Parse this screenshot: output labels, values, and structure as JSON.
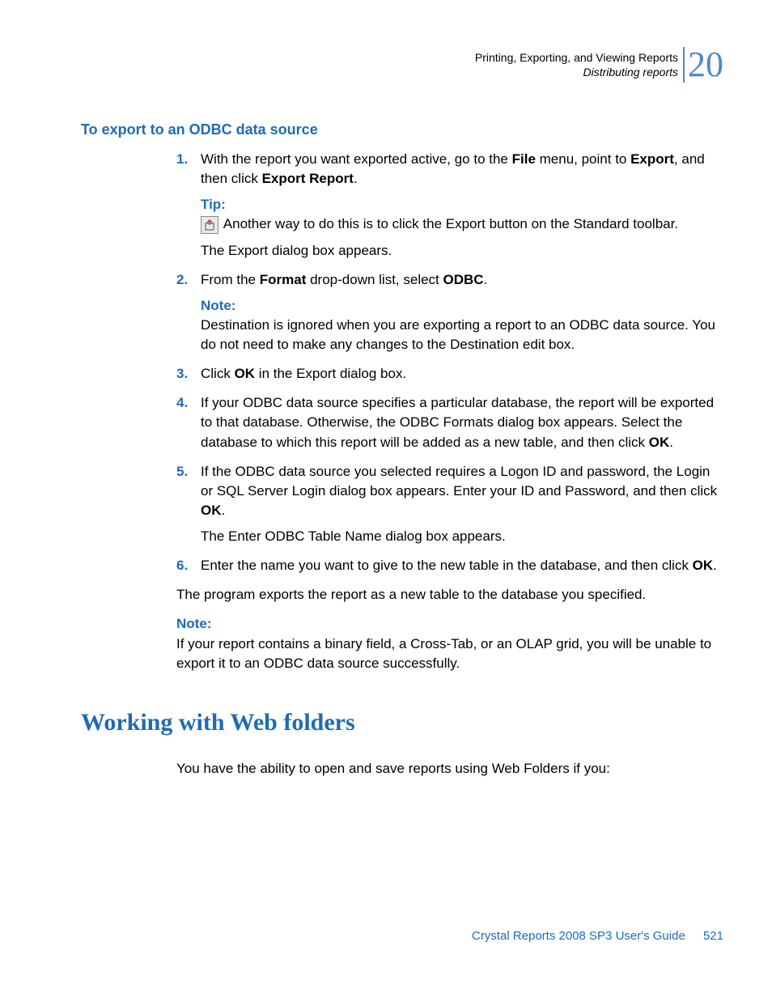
{
  "header": {
    "line1": "Printing, Exporting, and Viewing Reports",
    "line2": "Distributing reports",
    "chapter": "20"
  },
  "section_heading": "To export to an ODBC data source",
  "steps": [
    {
      "num": "1.",
      "parts": {
        "p1a": "With the report you want exported active, go to the ",
        "p1b": "File",
        "p1c": " menu, point to ",
        "p1d": "Export",
        "p1e": ", and then click ",
        "p1f": "Export Report",
        "p1g": ".",
        "tip_label": "Tip:",
        "tip_text": " Another way to do this is to click the Export button on the Standard toolbar.",
        "after": "The Export dialog box appears."
      }
    },
    {
      "num": "2.",
      "parts": {
        "p1a": "From the ",
        "p1b": "Format",
        "p1c": " drop-down list, select ",
        "p1d": "ODBC",
        "p1e": ".",
        "note_label": "Note:",
        "note_text": "Destination is ignored when you are exporting a report to an ODBC data source. You do not need to make any changes to the Destination edit box."
      }
    },
    {
      "num": "3.",
      "parts": {
        "p1a": "Click ",
        "p1b": "OK",
        "p1c": " in the Export dialog box."
      }
    },
    {
      "num": "4.",
      "parts": {
        "p1a": "If your ODBC data source specifies a particular database, the report will be exported to that database. Otherwise, the ODBC Formats dialog box appears. Select the database to which this report will be added as a new table, and then click ",
        "p1b": "OK",
        "p1c": "."
      }
    },
    {
      "num": "5.",
      "parts": {
        "p1a": "If the ODBC data source you selected requires a Logon ID and password, the Login or SQL Server Login dialog box appears. Enter your ID and Password, and then click ",
        "p1b": "OK",
        "p1c": ".",
        "after": "The Enter ODBC Table Name dialog box appears."
      }
    },
    {
      "num": "6.",
      "parts": {
        "p1a": "Enter the name you want to give to the new table in the database, and then click ",
        "p1b": "OK",
        "p1c": "."
      }
    }
  ],
  "closing": "The program exports the report as a new table to the database you specified.",
  "final_note": {
    "label": "Note:",
    "text": "If your report contains a binary field, a Cross-Tab, or an OLAP grid, you will be unable to export it to an ODBC data source successfully."
  },
  "h2": "Working with Web folders",
  "body2": "You have the ability to open and save reports using Web Folders if you:",
  "footer": {
    "title": "Crystal Reports 2008 SP3 User's Guide",
    "page": "521"
  }
}
